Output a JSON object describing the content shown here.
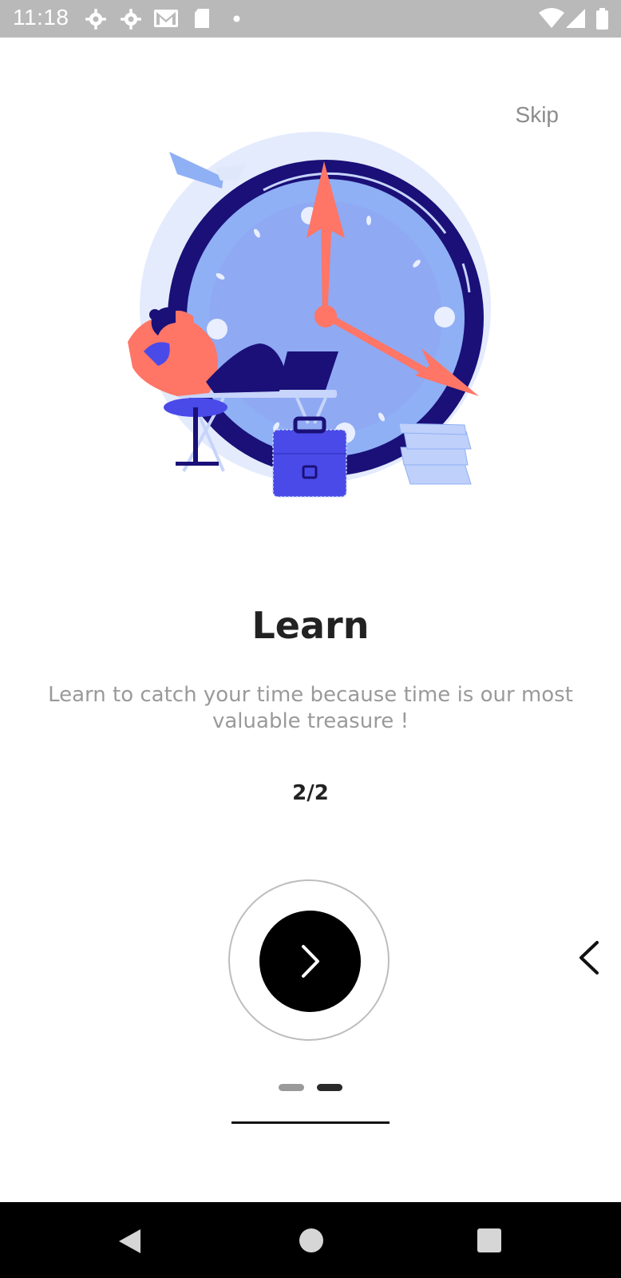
{
  "status_bar": {
    "time": "11:18",
    "left_icons": [
      "settings-icon",
      "settings-icon",
      "gmail-icon",
      "sd-card-icon",
      "dot-icon"
    ],
    "right_icons": [
      "wifi-icon",
      "signal-icon",
      "battery-icon"
    ]
  },
  "skip_label": "Skip",
  "onboarding": {
    "title": "Learn",
    "subtitle_line1": "Learn to catch your time because time is our most",
    "subtitle_line2": "valuable treasure !",
    "counter": "2/2",
    "page_indicator": {
      "total": 2,
      "active": 2
    }
  },
  "colors": {
    "status_bar": "#b9b9b9",
    "clock_face": "#8fb0f5",
    "clock_ring": "#1a1078",
    "hands": "#ff7566",
    "next_button": "#000000"
  },
  "nav_bar": {
    "icons": [
      "back-icon",
      "home-icon",
      "recents-icon"
    ]
  }
}
